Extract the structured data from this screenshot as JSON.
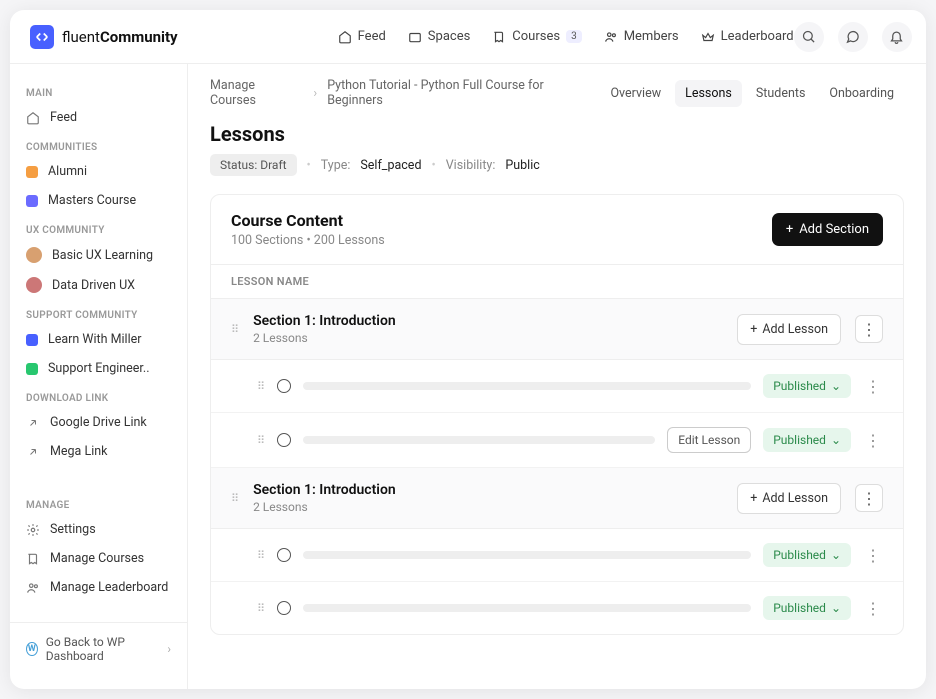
{
  "brand": {
    "name_light": "fluent",
    "name_bold": "Community"
  },
  "top_nav": {
    "feed": "Feed",
    "spaces": "Spaces",
    "courses": "Courses",
    "courses_badge": "3",
    "members": "Members",
    "leaderboard": "Leaderboard"
  },
  "sidebar": {
    "main_title": "MAIN",
    "feed": "Feed",
    "communities_title": "COMMUNITIES",
    "alumni": "Alumni",
    "masters": "Masters Course",
    "ux_title": "UX COMMUNITY",
    "basic_ux": "Basic UX Learning",
    "data_ux": "Data Driven UX",
    "support_title": "SUPPORT COMMUNITY",
    "learn_miller": "Learn With Miller",
    "support_eng": "Support Engineer..",
    "download_title": "DOWNLOAD LINK",
    "gdrive": "Google Drive Link",
    "mega": "Mega Link",
    "manage_title": "MANAGE",
    "settings": "Settings",
    "manage_courses": "Manage Courses",
    "manage_leaderboard": "Manage Leaderboard",
    "wp_link": "Go Back to WP Dashboard"
  },
  "breadcrumb": {
    "root": "Manage Courses",
    "current": "Python Tutorial - Python Full Course for Beginners"
  },
  "tabs": {
    "overview": "Overview",
    "lessons": "Lessons",
    "students": "Students",
    "onboarding": "Onboarding"
  },
  "page": {
    "title": "Lessons",
    "status_label": "Status:",
    "status_value": "Draft",
    "type_label": "Type:",
    "type_value": "Self_paced",
    "visibility_label": "Visibility:",
    "visibility_value": "Public"
  },
  "content": {
    "title": "Course Content",
    "subtitle": "100 Sections  •  200 Lessons",
    "add_section": "Add Section",
    "lesson_name_col": "LESSON NAME",
    "add_lesson": "Add Lesson",
    "edit_lesson": "Edit Lesson",
    "published": "Published",
    "sections": [
      {
        "title": "Section 1: Introduction",
        "sub": "2 Lessons"
      },
      {
        "title": "Section 1: Introduction",
        "sub": "2 Lessons"
      }
    ]
  }
}
